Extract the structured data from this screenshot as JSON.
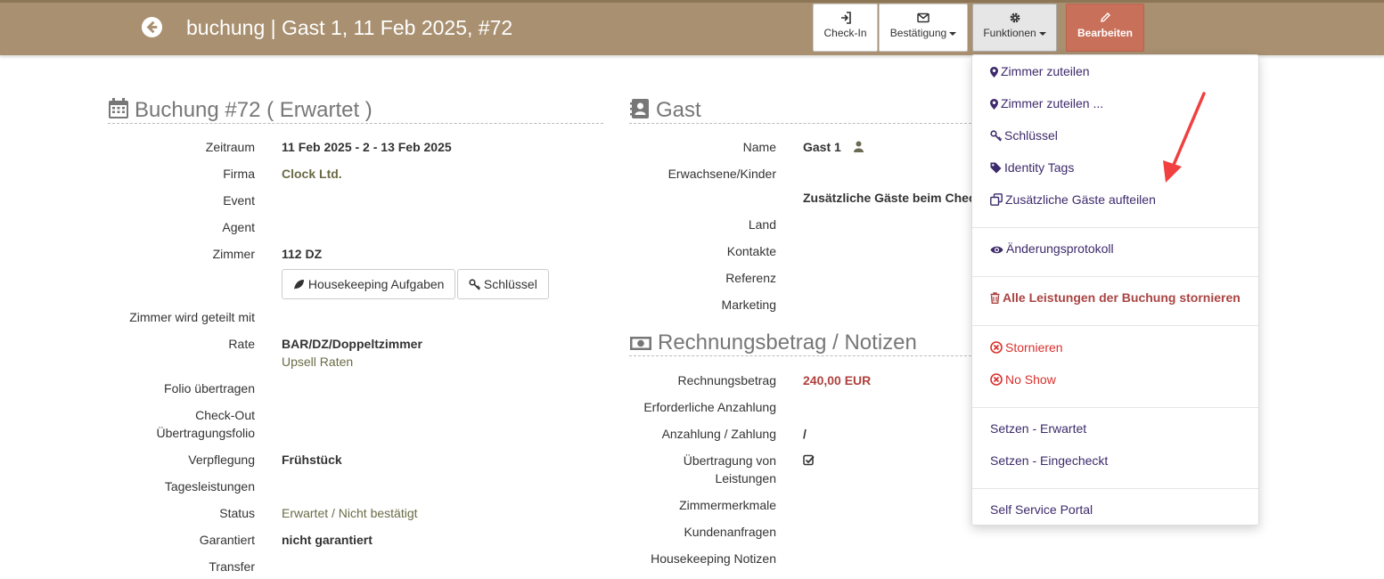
{
  "header": {
    "title": "buchung | Gast 1, 11 Feb 2025, #72",
    "buttons": {
      "checkin": "Check-In",
      "bestaetigung": "Bestätigung",
      "funktionen": "Funktionen",
      "bearbeiten": "Bearbeiten"
    }
  },
  "booking": {
    "title": "Buchung #72 ( Erwartet )",
    "labels": {
      "zeitraum": "Zeitraum",
      "firma": "Firma",
      "event": "Event",
      "agent": "Agent",
      "zimmer": "Zimmer",
      "geteilt": "Zimmer wird geteilt mit",
      "rate": "Rate",
      "folio": "Folio übertragen",
      "checkout1": "Check-Out",
      "checkout2": "Übertragungsfolio",
      "verpflegung": "Verpflegung",
      "tagesleistungen": "Tagesleistungen",
      "status": "Status",
      "garantiert": "Garantiert",
      "transfer": "Transfer"
    },
    "values": {
      "zeitraum": "11 Feb 2025 - 2 - 13 Feb 2025",
      "firma": "Clock Ltd.",
      "zimmer": "112 DZ",
      "rate": "BAR/DZ/Doppeltzimmer",
      "upsell": "Upsell Raten",
      "verpflegung": "Frühstück",
      "status": "Erwartet / Nicht bestätigt",
      "garantiert": "nicht garantiert"
    },
    "buttons": {
      "housekeeping": "Housekeeping Aufgaben",
      "schluessel": "Schlüssel"
    }
  },
  "guest": {
    "title": "Gast",
    "labels": {
      "name": "Name",
      "erwachsene": "Erwachsene/Kinder",
      "land": "Land",
      "kontakte": "Kontakte",
      "referenz": "Referenz",
      "marketing": "Marketing"
    },
    "values": {
      "name": "Gast 1",
      "zusaetzlich": "Zusätzliche Gäste beim Chec"
    }
  },
  "invoice": {
    "title": "Rechnungsbetrag / Notizen",
    "labels": {
      "rechnungsbetrag": "Rechnungsbetrag",
      "anzahlung_req": "Erforderliche Anzahlung",
      "anzahlung": "Anzahlung / Zahlung",
      "uebertragung1": "Übertragung von",
      "uebertragung2": "Leistungen",
      "zimmermerkmale": "Zimmermerkmale",
      "kundenanfragen": "Kundenanfragen",
      "housekeeping_notizen": "Housekeeping Notizen"
    },
    "values": {
      "rechnungsbetrag": "240,00 EUR",
      "anzahlung": "/"
    }
  },
  "menu": {
    "items": [
      "Zimmer zuteilen",
      "Zimmer zuteilen ...",
      "Schlüssel",
      "Identity Tags",
      "Zusätzliche Gäste aufteilen",
      "Änderungsprotokoll",
      "Alle Leistungen der Buchung stornieren",
      "Stornieren",
      "No Show",
      "Setzen - Erwartet",
      "Setzen - Eingecheckt",
      "Self Service Portal"
    ]
  },
  "colors": {
    "header": "#a89070",
    "edit_button": "#c9705a",
    "menu_link": "#3d2a6b",
    "danger": "#d9302c",
    "arrow": "#f04040"
  }
}
